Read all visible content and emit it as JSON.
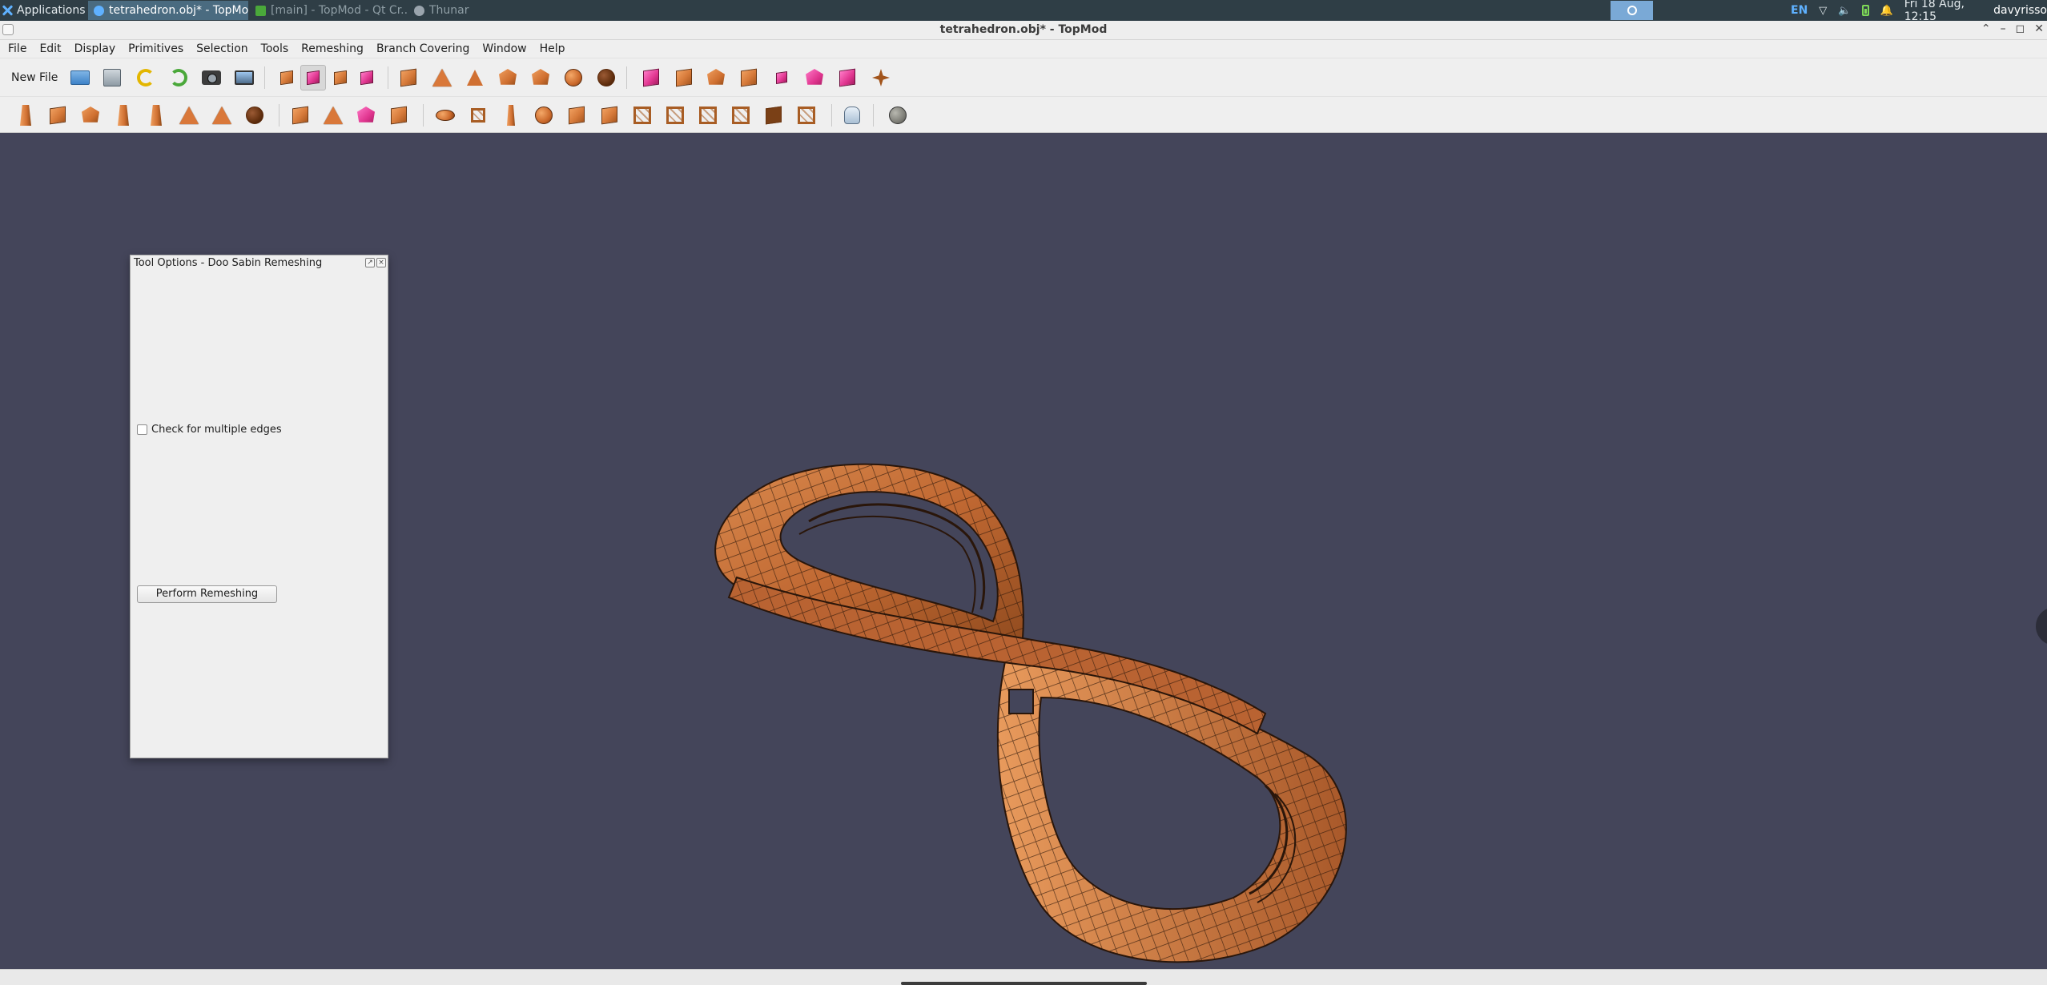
{
  "system_panel": {
    "applications_label": "Applications",
    "tasks": [
      {
        "label": "tetrahedron.obj* - TopMod",
        "active": true
      },
      {
        "label": "[main] - TopMod - Qt Cr...",
        "active": false
      },
      {
        "label": "Thunar",
        "active": false
      }
    ],
    "tray": {
      "keyboard_layout": "EN",
      "datetime": "Fri 18 Aug, 12:15",
      "user": "davyrisso"
    }
  },
  "window": {
    "title": "tetrahedron.obj* - TopMod"
  },
  "menubar": {
    "items": [
      {
        "label": "File",
        "mnemonic": "F"
      },
      {
        "label": "Edit",
        "mnemonic": "E"
      },
      {
        "label": "Display",
        "mnemonic": "D"
      },
      {
        "label": "Primitives",
        "mnemonic": "P"
      },
      {
        "label": "Selection",
        "mnemonic": "S"
      },
      {
        "label": "Tools",
        "mnemonic": "T"
      },
      {
        "label": "Remeshing",
        "mnemonic": "R"
      },
      {
        "label": "Branch Covering",
        "mnemonic": "B"
      },
      {
        "label": "Window",
        "mnemonic": "W"
      },
      {
        "label": "Help",
        "mnemonic": "H"
      }
    ]
  },
  "toolbar": {
    "new_file_label": "New File"
  },
  "tool_options": {
    "title": "Tool Options - Doo Sabin Remeshing",
    "check_multiple_edges_label": "Check for multiple edges",
    "check_multiple_edges_checked": false,
    "perform_button_label": "Perform Remeshing"
  },
  "colors": {
    "viewport_bg": "#44455a",
    "mesh_fill": "#c8743d",
    "mesh_edge": "#2a160a",
    "accent_pink": "#e0358f"
  },
  "icons": {
    "toolbar1": [
      "folder-icon",
      "save-icon",
      "undo-icon",
      "redo-icon",
      "camera-icon",
      "screenshot-icon",
      "vertex-mode-icon",
      "face-mode-icon",
      "edge-mode-icon",
      "corner-mode-icon",
      "cube-icon",
      "tetrahedron-icon",
      "triangle-icon",
      "dodecahedron-icon",
      "icosahedron-icon",
      "soccerball-icon",
      "sphere-icon",
      "extrude-icon",
      "insert-edge-icon",
      "bevel-icon",
      "split-face-icon",
      "connect-icon",
      "subdivide-icon",
      "sculpt-icon",
      "handle-icon"
    ],
    "toolbar2": [
      "doo-sabin-icon",
      "catmull-clark-icon",
      "honeycomb-icon",
      "root3-icon",
      "loop-icon",
      "pentagonal-icon",
      "star-icon",
      "dome-icon",
      "corner-cut-icon",
      "linear-vertex-icon",
      "vertex-cut-icon",
      "face-cut-icon",
      "dual-icon",
      "fractal-icon",
      "stellate-icon",
      "column-icon",
      "spiral-icon",
      "twist-icon",
      "wireframe-icon",
      "wireframe2-icon",
      "cage-icon",
      "mesh-cage-icon",
      "frame-cube-icon",
      "frame-icon",
      "lattice-icon",
      "hand-tool-icon",
      "texture-ball-icon"
    ]
  }
}
